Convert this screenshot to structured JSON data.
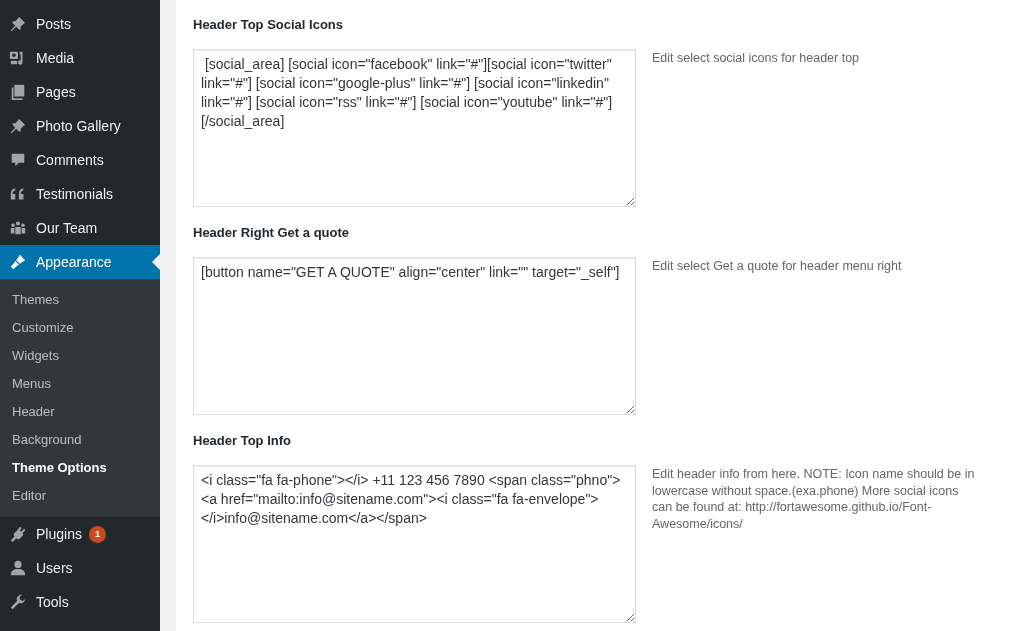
{
  "sidebar": {
    "items": [
      {
        "label": "Posts",
        "selected": false
      },
      {
        "label": "Media",
        "selected": false
      },
      {
        "label": "Pages",
        "selected": false
      },
      {
        "label": "Photo Gallery",
        "selected": false
      },
      {
        "label": "Comments",
        "selected": false
      },
      {
        "label": "Testimonials",
        "selected": false
      },
      {
        "label": "Our Team",
        "selected": false
      },
      {
        "label": "Appearance",
        "selected": true,
        "children": [
          {
            "label": "Themes",
            "selected": false
          },
          {
            "label": "Customize",
            "selected": false
          },
          {
            "label": "Widgets",
            "selected": false
          },
          {
            "label": "Menus",
            "selected": false
          },
          {
            "label": "Header",
            "selected": false
          },
          {
            "label": "Background",
            "selected": false
          },
          {
            "label": "Theme Options",
            "selected": true
          },
          {
            "label": "Editor",
            "selected": false
          }
        ]
      },
      {
        "label": "Plugins",
        "selected": false,
        "badge": "1"
      },
      {
        "label": "Users",
        "selected": false
      },
      {
        "label": "Tools",
        "selected": false
      }
    ]
  },
  "fields": [
    {
      "label": "Header Top Social Icons",
      "value": " [social_area] [social icon=\"facebook\" link=\"#\"][social icon=\"twitter\" link=\"#\"] [social icon=\"google-plus\" link=\"#\"] [social icon=\"linkedin\" link=\"#\"] [social icon=\"rss\" link=\"#\"] [social icon=\"youtube\" link=\"#\"][/social_area]",
      "description": "Edit select social icons for header top"
    },
    {
      "label": "Header Right Get a quote",
      "value": "[button name=\"GET A QUOTE\" align=\"center\" link=\"\" target=\"_self\"]",
      "description": "Edit select Get a quote for header menu right"
    },
    {
      "label": "Header Top Info",
      "value": "<i class=\"fa fa-phone\"></i> +11 123 456 7890 <span class=\"phno\"><a href=\"mailto:info@sitename.com\"><i class=\"fa fa-envelope\"></i>info@sitename.com</a></span>",
      "description": "Edit header info from here. NOTE: Icon name should be in lowercase without space.(exa.phone) More social icons can be found at: http://fortawesome.github.io/Font-Awesome/icons/"
    }
  ]
}
